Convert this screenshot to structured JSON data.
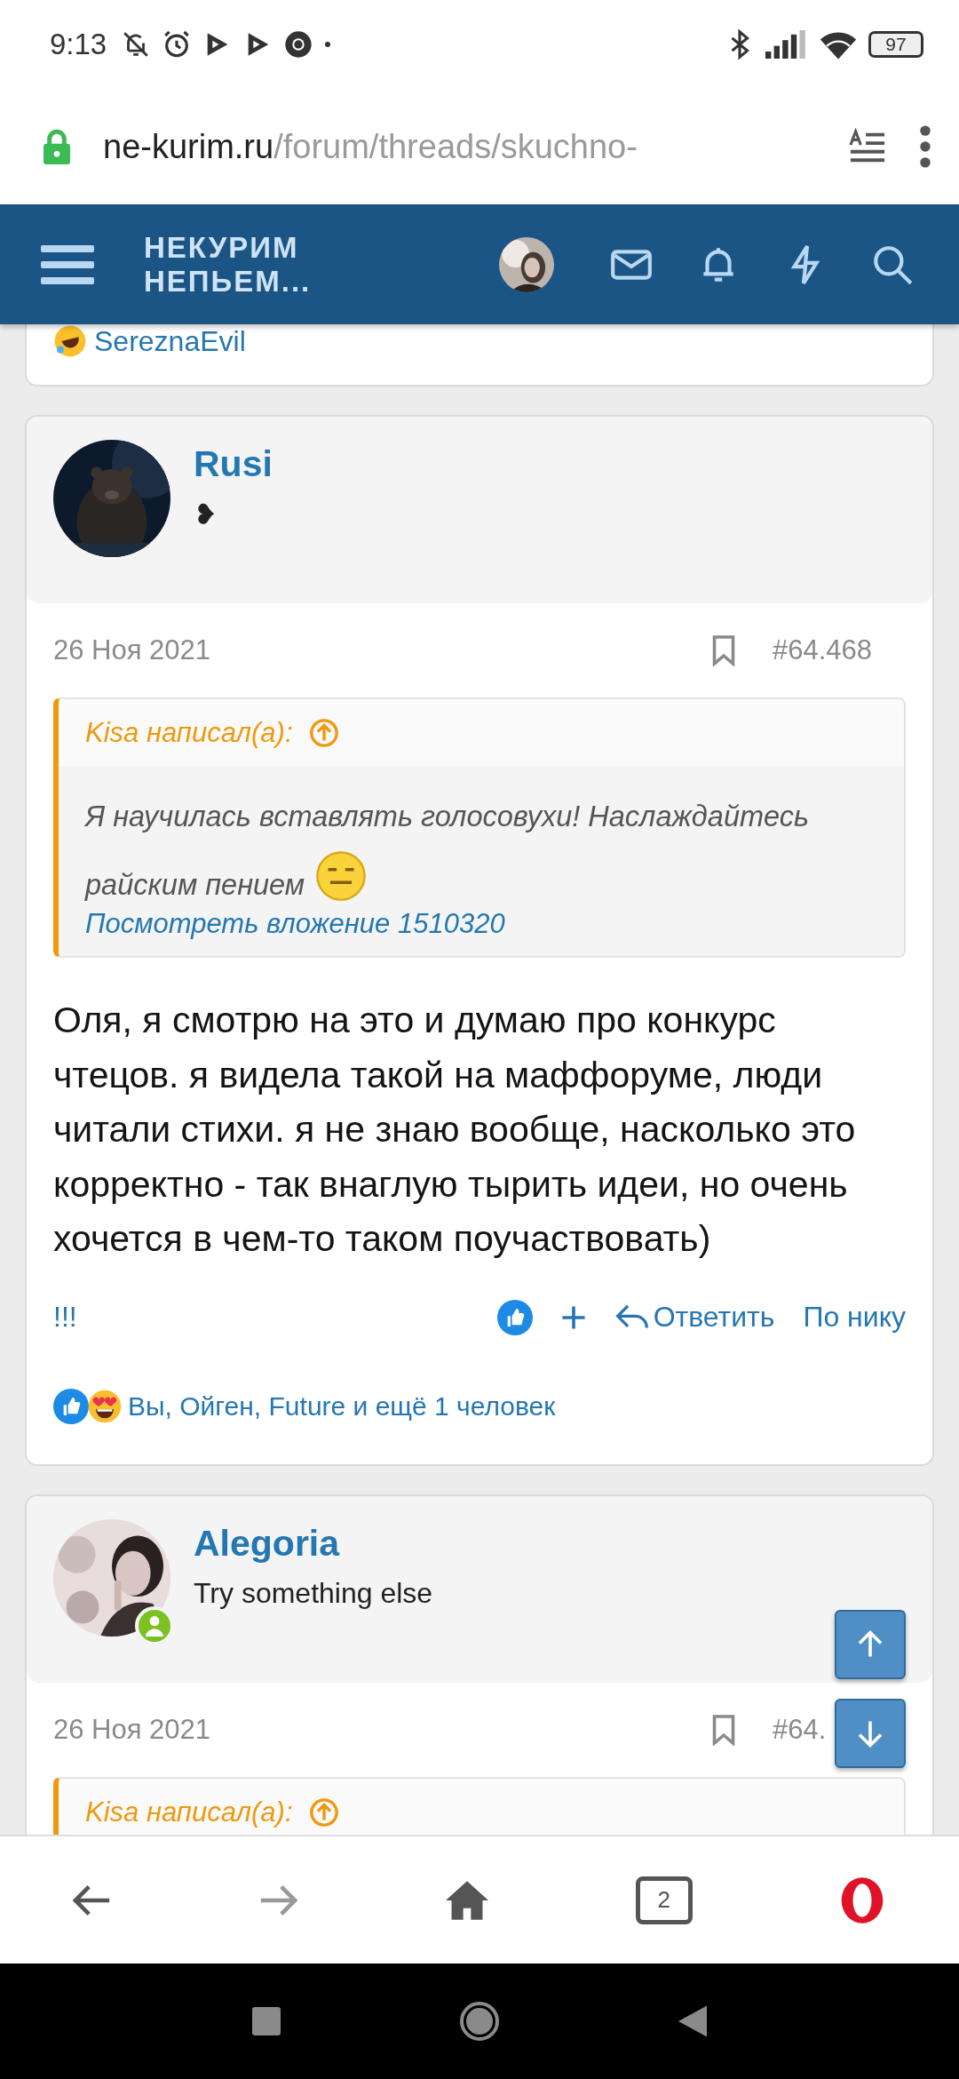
{
  "status_bar": {
    "time": "9:13",
    "battery": "97"
  },
  "url_bar": {
    "domain": "ne-kurim.ru",
    "path": "/forum/threads/skuchno-"
  },
  "site_header": {
    "logo_lines": [
      "НЕКУРИМ",
      "НЕПЬЕМ..."
    ]
  },
  "previous_post": {
    "reactions": "SereznaEvil"
  },
  "posts": [
    {
      "author": "Rusi",
      "user_title": "❥",
      "online": false,
      "date": "26 Ноя 2021",
      "number": "#64.468",
      "quote": {
        "author_line": "Kisa написал(а):",
        "text": "Я научилась вставлять голосовухи! Наслаждайтесь райским пением",
        "attachment_link": "Посмотреть вложение 1510320"
      },
      "body": "Оля, я смотрю на это и думаю про конкурс чтецов. я видела такой на маффоруме, люди читали стихи. я не знаю вообще, насколько это корректно - так внаглую тырить идеи, но очень хочется в чем-то таком поучаствовать)",
      "actions": {
        "left": "!!!",
        "reply": "Ответить",
        "by_nick": "По нику"
      },
      "reactions": "Вы, Ойген, Future и ещё 1 человек"
    },
    {
      "author": "Alegoria",
      "user_title": "Try something else",
      "online": true,
      "date": "26 Ноя 2021",
      "number": "#64.",
      "quote": {
        "author_line": "Kisa написал(а):"
      }
    }
  ],
  "browser_nav": {
    "tab_count": "2"
  }
}
